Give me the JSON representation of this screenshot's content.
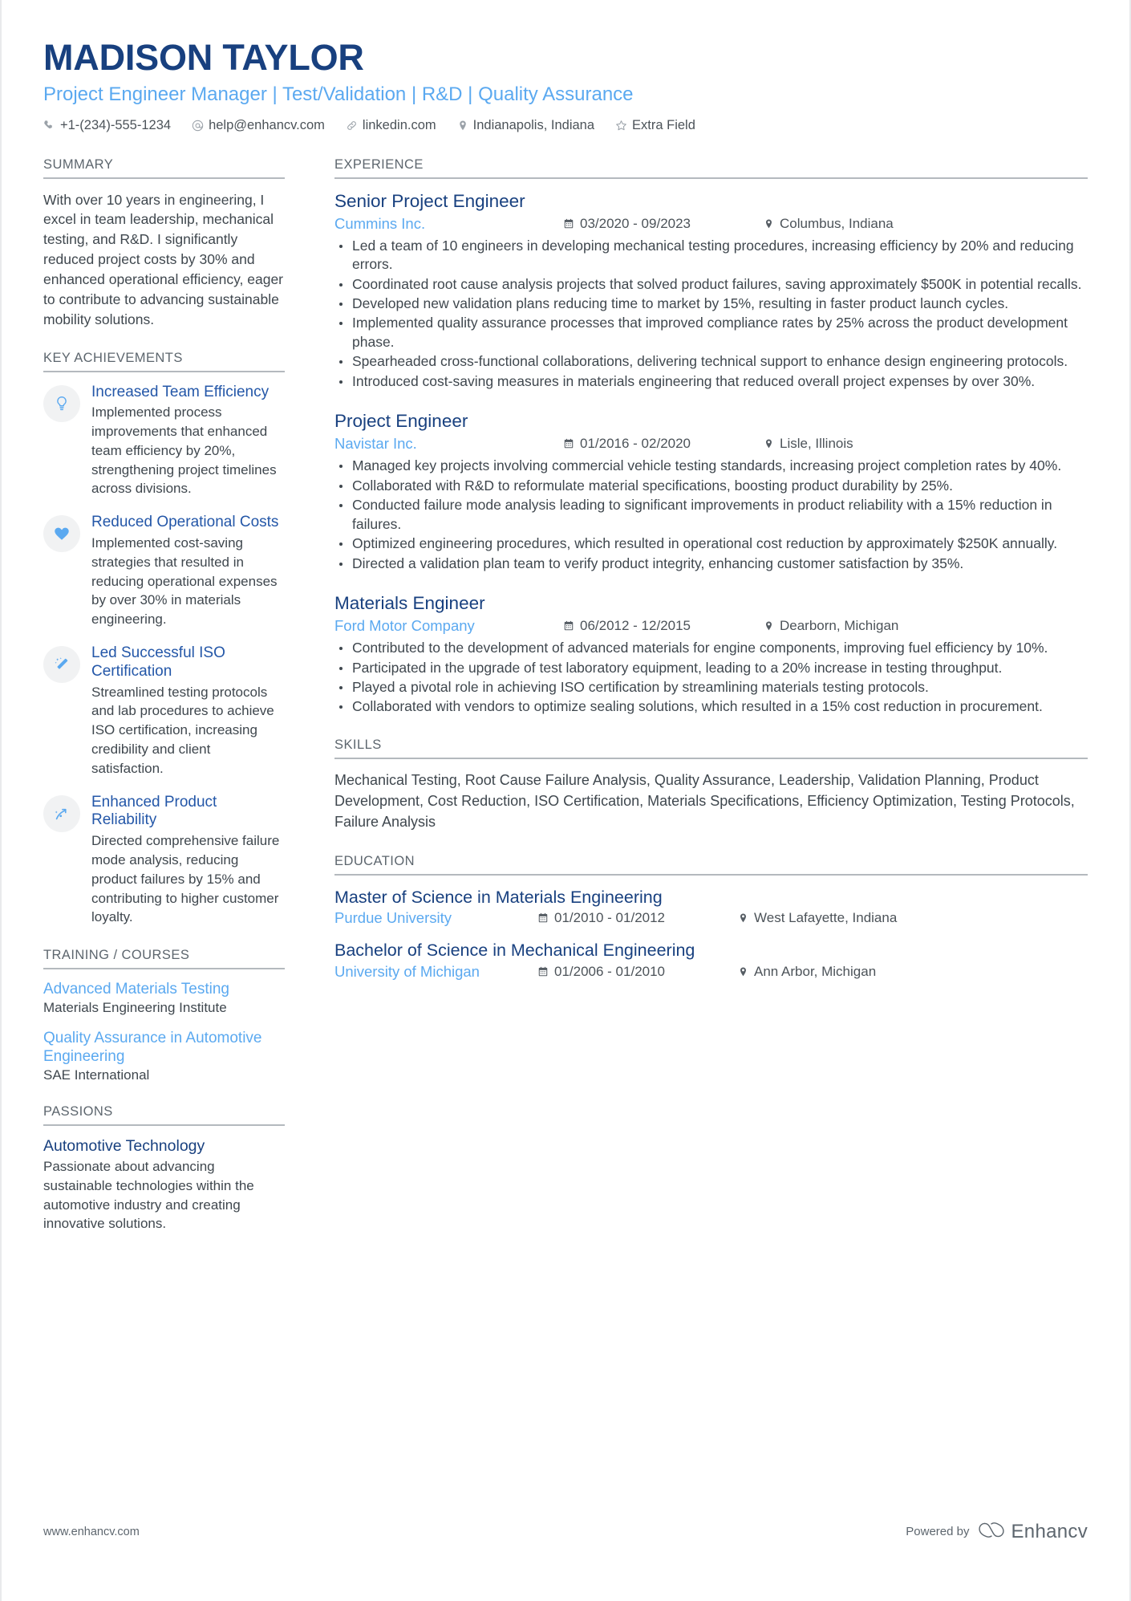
{
  "header": {
    "full_name": "MADISON TAYLOR",
    "headline": "Project Engineer Manager | Test/Validation | R&D | Quality Assurance",
    "contacts": [
      {
        "icon": "phone-icon",
        "text": "+1-(234)-555-1234"
      },
      {
        "icon": "email-icon",
        "text": "help@enhancv.com"
      },
      {
        "icon": "link-icon",
        "text": "linkedin.com"
      },
      {
        "icon": "location-pin-icon",
        "text": "Indianapolis, Indiana"
      },
      {
        "icon": "star-icon",
        "text": "Extra Field"
      }
    ]
  },
  "summary": {
    "title": "SUMMARY",
    "text": "With over 10 years in engineering, I excel in team leadership, mechanical testing, and R&D. I significantly reduced project costs by 30% and enhanced operational efficiency, eager to contribute to advancing sustainable mobility solutions."
  },
  "achievements": {
    "title": "KEY ACHIEVEMENTS",
    "items": [
      {
        "icon": "lightbulb-icon",
        "title": "Increased Team Efficiency",
        "desc": "Implemented process improvements that enhanced team efficiency by 20%, strengthening project timelines across divisions."
      },
      {
        "icon": "heart-icon",
        "title": "Reduced Operational Costs",
        "desc": "Implemented cost-saving strategies that resulted in reducing operational expenses by over 30% in materials engineering."
      },
      {
        "icon": "magic-wand-icon",
        "title": "Led Successful ISO Certification",
        "desc": "Streamlined testing protocols and lab procedures to achieve ISO certification, increasing credibility and client satisfaction."
      },
      {
        "icon": "trend-arrow-icon",
        "title": "Enhanced Product Reliability",
        "desc": "Directed comprehensive failure mode analysis, reducing product failures by 15% and contributing to higher customer loyalty."
      }
    ]
  },
  "training": {
    "title": "TRAINING / COURSES",
    "items": [
      {
        "name": "Advanced Materials Testing",
        "org": "Materials Engineering Institute"
      },
      {
        "name": "Quality Assurance in Automotive Engineering",
        "org": "SAE International"
      }
    ]
  },
  "passions": {
    "title": "PASSIONS",
    "items": [
      {
        "name": "Automotive Technology",
        "desc": "Passionate about advancing sustainable technologies within the automotive industry and creating innovative solutions."
      }
    ]
  },
  "experience": {
    "title": "EXPERIENCE",
    "jobs": [
      {
        "position": "Senior Project Engineer",
        "company": "Cummins Inc.",
        "dates": "03/2020 - 09/2023",
        "location": "Columbus, Indiana",
        "bullets": [
          "Led a team of 10 engineers in developing mechanical testing procedures, increasing efficiency by 20% and reducing errors.",
          "Coordinated root cause analysis projects that solved product failures, saving approximately $500K in potential recalls.",
          "Developed new validation plans reducing time to market by 15%, resulting in faster product launch cycles.",
          "Implemented quality assurance processes that improved compliance rates by 25% across the product development phase.",
          "Spearheaded cross-functional collaborations, delivering technical support to enhance design engineering protocols.",
          "Introduced cost-saving measures in materials engineering that reduced overall project expenses by over 30%."
        ]
      },
      {
        "position": "Project Engineer",
        "company": "Navistar Inc.",
        "dates": "01/2016 - 02/2020",
        "location": "Lisle, Illinois",
        "bullets": [
          "Managed key projects involving commercial vehicle testing standards, increasing project completion rates by 40%.",
          "Collaborated with R&D to reformulate material specifications, boosting product durability by 25%.",
          "Conducted failure mode analysis leading to significant improvements in product reliability with a 15% reduction in failures.",
          "Optimized engineering procedures, which resulted in operational cost reduction by approximately $250K annually.",
          "Directed a validation plan team to verify product integrity, enhancing customer satisfaction by 35%."
        ]
      },
      {
        "position": "Materials Engineer",
        "company": "Ford Motor Company",
        "dates": "06/2012 - 12/2015",
        "location": "Dearborn, Michigan",
        "bullets": [
          "Contributed to the development of advanced materials for engine components, improving fuel efficiency by 10%.",
          "Participated in the upgrade of test laboratory equipment, leading to a 20% increase in testing throughput.",
          "Played a pivotal role in achieving ISO certification by streamlining materials testing protocols.",
          "Collaborated with vendors to optimize sealing solutions, which resulted in a 15% cost reduction in procurement."
        ]
      }
    ]
  },
  "skills": {
    "title": "SKILLS",
    "text": "Mechanical Testing, Root Cause Failure Analysis, Quality Assurance, Leadership, Validation Planning, Product Development, Cost Reduction, ISO Certification, Materials Specifications, Efficiency Optimization, Testing Protocols, Failure Analysis"
  },
  "education": {
    "title": "EDUCATION",
    "items": [
      {
        "degree": "Master of Science in Materials Engineering",
        "school": "Purdue University",
        "dates": "01/2010 - 01/2012",
        "location": "West Lafayette, Indiana"
      },
      {
        "degree": "Bachelor of Science in Mechanical Engineering",
        "school": "University of Michigan",
        "dates": "01/2006 - 01/2010",
        "location": "Ann Arbor, Michigan"
      }
    ]
  },
  "footer": {
    "website": "www.enhancv.com",
    "powered_by": "Powered by",
    "brand": "Enhancv"
  },
  "colors": {
    "navy": "#18407f",
    "light_blue": "#5ba9f0",
    "mid_blue": "#2457a8",
    "body_text": "#3f474e",
    "muted": "#5d666e",
    "rule": "#b4b9be"
  }
}
